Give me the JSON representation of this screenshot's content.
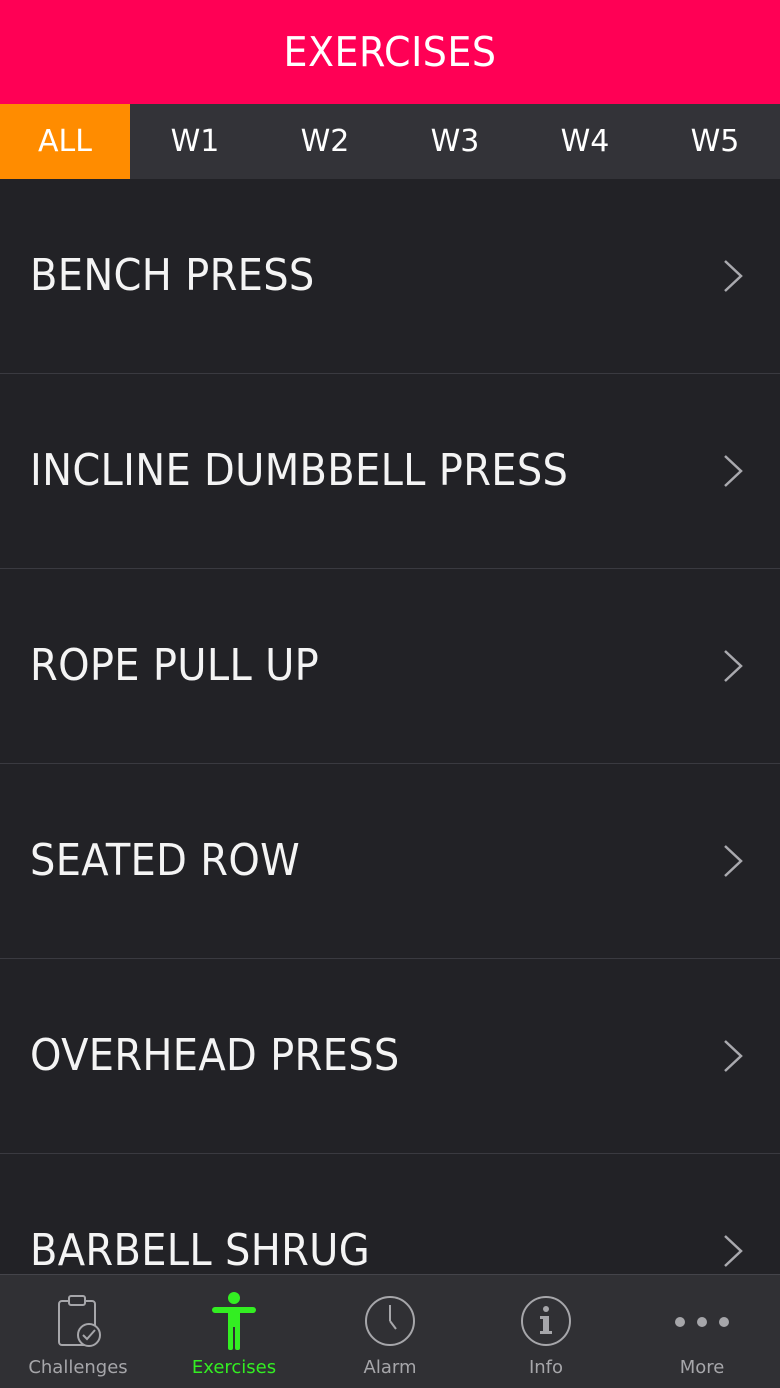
{
  "header": {
    "title": "EXERCISES"
  },
  "tabs": [
    {
      "label": "ALL",
      "active": true
    },
    {
      "label": "W1",
      "active": false
    },
    {
      "label": "W2",
      "active": false
    },
    {
      "label": "W3",
      "active": false
    },
    {
      "label": "W4",
      "active": false
    },
    {
      "label": "W5",
      "active": false
    }
  ],
  "exercises": [
    {
      "label": "BENCH PRESS"
    },
    {
      "label": "INCLINE DUMBBELL PRESS"
    },
    {
      "label": "ROPE PULL UP"
    },
    {
      "label": "SEATED ROW"
    },
    {
      "label": "OVERHEAD PRESS"
    },
    {
      "label": "BARBELL SHRUG"
    }
  ],
  "tabbar": [
    {
      "label": "Challenges",
      "icon": "clipboard-check-icon",
      "active": false
    },
    {
      "label": "Exercises",
      "icon": "person-figure-icon",
      "active": true
    },
    {
      "label": "Alarm",
      "icon": "clock-icon",
      "active": false
    },
    {
      "label": "Info",
      "icon": "info-icon",
      "active": false
    },
    {
      "label": "More",
      "icon": "more-dots-icon",
      "active": false
    }
  ],
  "colors": {
    "header_bg": "#ff0055",
    "tab_active_bg": "#ff8c00",
    "tabbar_active": "#33ee22",
    "background": "#222226"
  }
}
